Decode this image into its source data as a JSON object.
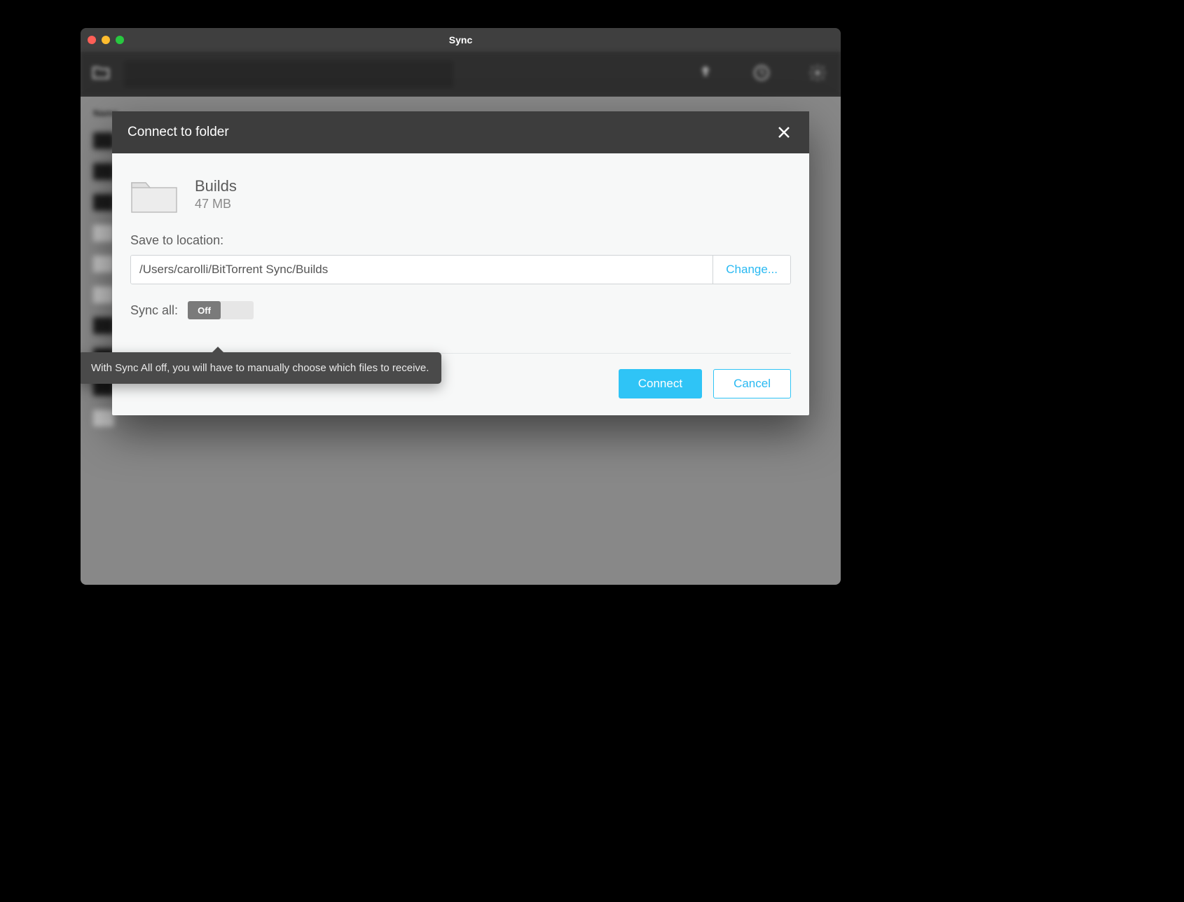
{
  "window": {
    "title": "Sync"
  },
  "bg_list": {
    "column_header": "Name"
  },
  "modal": {
    "title": "Connect to folder",
    "folder": {
      "name": "Builds",
      "size": "47 MB"
    },
    "location": {
      "label": "Save to location:",
      "path": "/Users/carolli/BitTorrent Sync/Builds",
      "change_label": "Change..."
    },
    "sync_all": {
      "label": "Sync all:",
      "state_label": "Off",
      "tooltip": "With Sync All off, you will have to manually choose which files to receive."
    },
    "buttons": {
      "connect": "Connect",
      "cancel": "Cancel"
    }
  }
}
